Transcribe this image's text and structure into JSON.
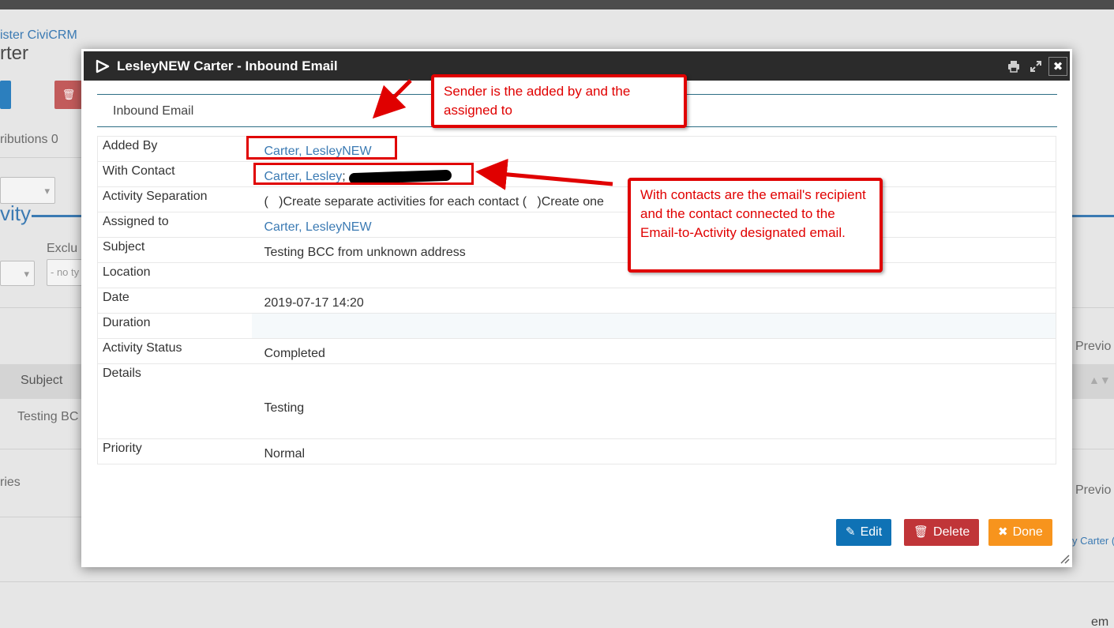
{
  "background": {
    "breadcrumb": "ister CiviCRM",
    "contact_title": "rter",
    "tab_contributions": "ributions 0",
    "section_heading": "vity",
    "exclude_label": "Exclu",
    "no_type_select": "- no ty",
    "table_header_subject": "Subject",
    "row_subject": "Testing BC",
    "entries_text": "ries",
    "previous_1": "Previo",
    "previous_2": "Previo",
    "added_by_snippet": "y Carter (",
    "bottom_text": "em"
  },
  "dialog": {
    "title": "LesleyNEW Carter - Inbound Email",
    "section_label": "Inbound Email",
    "fields": {
      "added_by_label": "Added By",
      "added_by_value": "Carter, LesleyNEW",
      "with_contact_label": "With Contact",
      "with_contact_value": "Carter, Lesley",
      "with_contact_sep": ";",
      "activity_separation_label": "Activity Separation",
      "activity_separation_value": "(   )Create separate activities for each contact (   )Create one",
      "assigned_to_label": "Assigned to",
      "assigned_to_value": "Carter, LesleyNEW",
      "subject_label": "Subject",
      "subject_value": "Testing BCC from unknown address",
      "location_label": "Location",
      "location_value": "",
      "date_label": "Date",
      "date_value": "2019-07-17 14:20",
      "duration_label": "Duration",
      "duration_value": "",
      "activity_status_label": "Activity Status",
      "activity_status_value": "Completed",
      "details_label": "Details",
      "details_value": "Testing",
      "priority_label": "Priority",
      "priority_value": "Normal"
    },
    "buttons": {
      "edit": "Edit",
      "delete": "Delete",
      "done": "Done"
    },
    "icons": [
      "print-icon",
      "expand-icon",
      "close-icon",
      "civicrm-logo-icon",
      "pencil-icon",
      "trash-icon",
      "x-icon"
    ]
  },
  "annotations": {
    "sender_note": "Sender is the added by and the assigned to",
    "contacts_note": "With contacts are the email's recipient and the contact connected to the Email-to-Activity designated email."
  },
  "colors": {
    "edit": "#0f72b5",
    "delete": "#c03538",
    "done": "#f7941d",
    "annotation": "#e00000",
    "link": "#3b7ab3"
  }
}
